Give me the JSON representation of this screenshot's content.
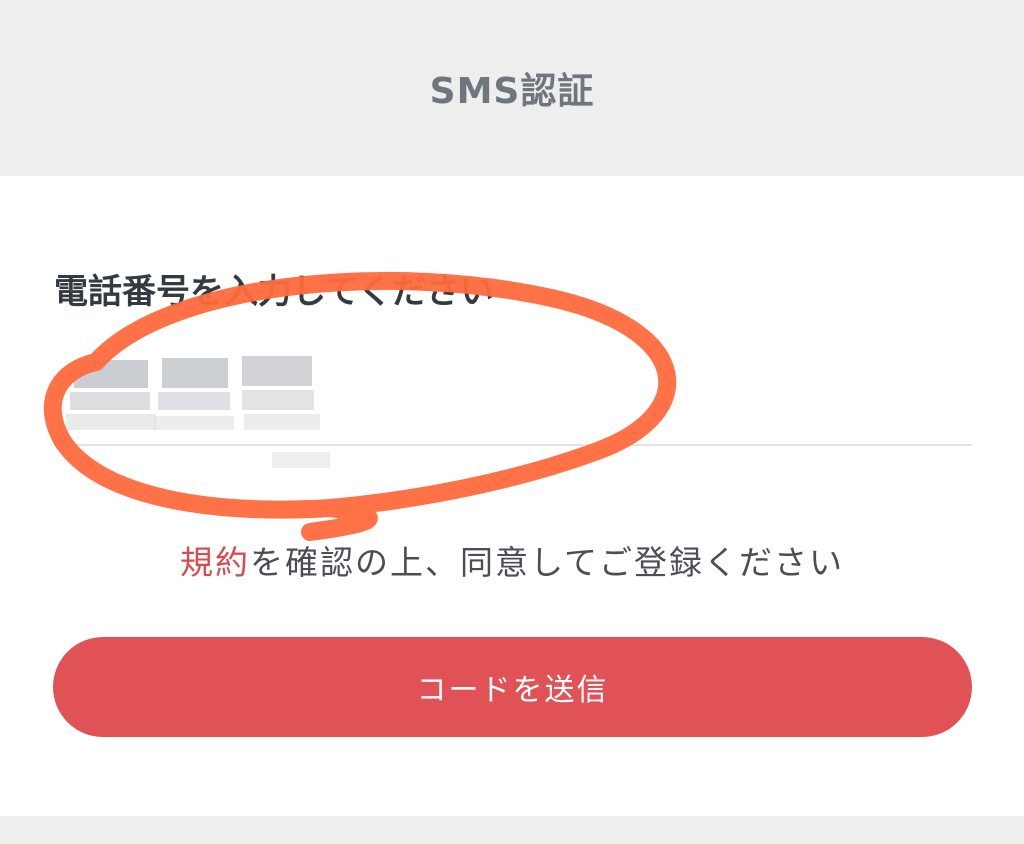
{
  "header": {
    "title": "SMS認証"
  },
  "form": {
    "phone_label": "電話番号を入力してください",
    "phone_value": "",
    "terms_link": "規約",
    "terms_rest": "を確認の上、同意してご登録ください",
    "send_button_label": "コードを送信"
  },
  "colors": {
    "accent": "#e05255",
    "link": "#dc4a4f",
    "annotation_stroke": "#ff6a3d",
    "header_bg": "#eeeeee"
  }
}
